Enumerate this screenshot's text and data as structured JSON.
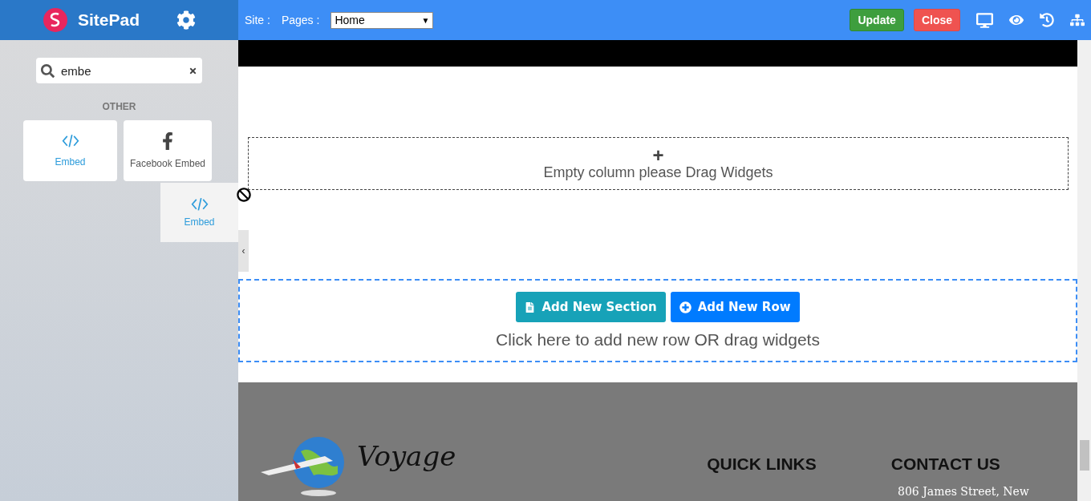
{
  "brand": {
    "name": "SitePad"
  },
  "toolbar": {
    "site_label": "Site :",
    "pages_label": "Pages :",
    "page_select": "Home",
    "select_caret": "▼",
    "buttons": [
      {
        "label": "Update",
        "kind": "update"
      },
      {
        "label": "Close",
        "kind": "close"
      }
    ]
  },
  "sidebar": {
    "search": {
      "value": "embe"
    },
    "category": "OTHER",
    "widgets": [
      {
        "label": "Embed",
        "kind": "code"
      },
      {
        "label": "Facebook Embed",
        "kind": "facebook"
      }
    ]
  },
  "drag_ghost": {
    "label": "Embed"
  },
  "canvas": {
    "empty_column": {
      "icon": "+",
      "text": "Empty column please Drag Widgets"
    },
    "collapse": "‹",
    "add_section": {
      "buttons": [
        {
          "label": "Add New Section",
          "kind": "section"
        },
        {
          "label": "Add New Row",
          "kind": "row"
        }
      ],
      "hint": "Click here to add new row OR drag widgets"
    },
    "footer": {
      "logo_text": "Voyage",
      "headings": [
        "QUICK LINKS",
        "CONTACT US"
      ],
      "address": "806 James Street, New"
    }
  }
}
